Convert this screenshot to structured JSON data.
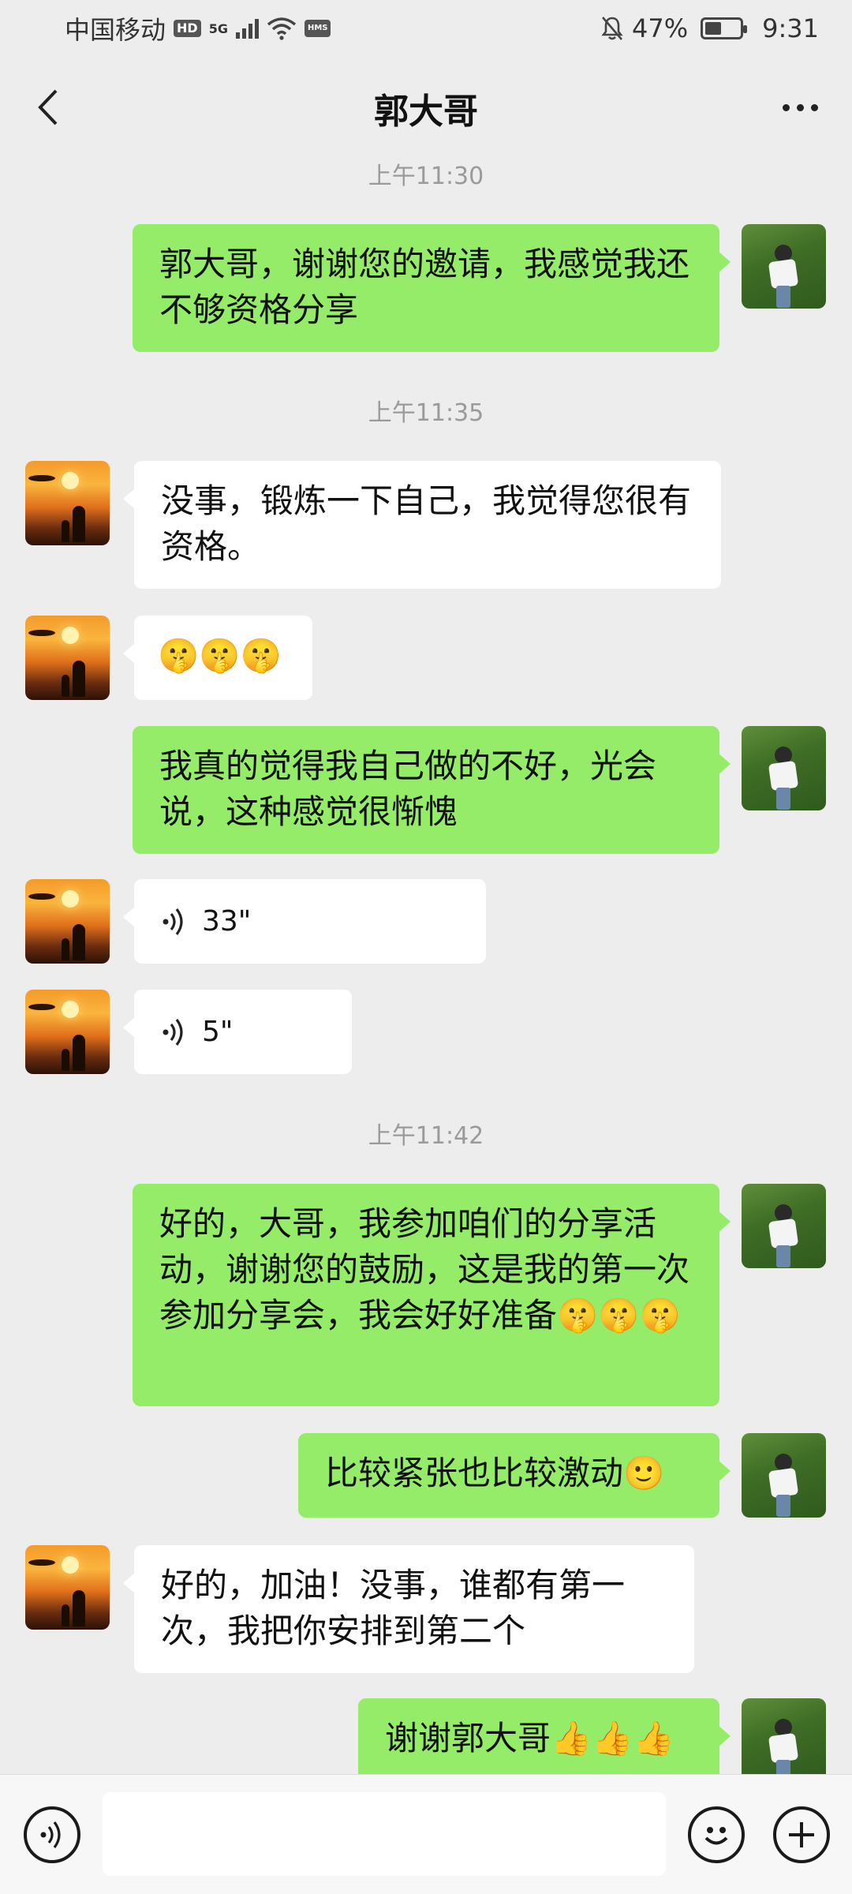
{
  "status_bar": {
    "carrier": "中国移动",
    "hd_badge": "HD",
    "network": "5G",
    "hms_badge": "HMS",
    "battery_percent": "47%",
    "battery_level": 0.47,
    "time": "9:31"
  },
  "header": {
    "title": "郭大哥"
  },
  "chat": {
    "timestamps": [
      "上午11:30",
      "上午11:35",
      "上午11:42"
    ],
    "messages": [
      {
        "side": "right",
        "text": "郭大哥，谢谢您的邀请，我感觉我还不够资格分享"
      },
      {
        "side": "left",
        "text": "没事，锻炼一下自己，我觉得您很有资格。"
      },
      {
        "side": "left",
        "text": "🤫🤫🤫"
      },
      {
        "side": "right",
        "text": "我真的觉得我自己做的不好，光会说，这种感觉很惭愧"
      },
      {
        "side": "left",
        "type": "voice",
        "duration": "33\""
      },
      {
        "side": "left",
        "type": "voice",
        "duration": "5\""
      },
      {
        "side": "right",
        "text": "好的，大哥，我参加咱们的分享活动，谢谢您的鼓励，这是我的第一次参加分享会，我会好好准备🤫🤫🤫"
      },
      {
        "side": "right",
        "text": "比较紧张也比较激动🙂"
      },
      {
        "side": "left",
        "text": "好的，加油！没事，谁都有第一次，我把你安排到第二个"
      },
      {
        "side": "right",
        "text": "谢谢郭大哥👍👍👍"
      }
    ]
  },
  "input_bar": {
    "value": ""
  }
}
